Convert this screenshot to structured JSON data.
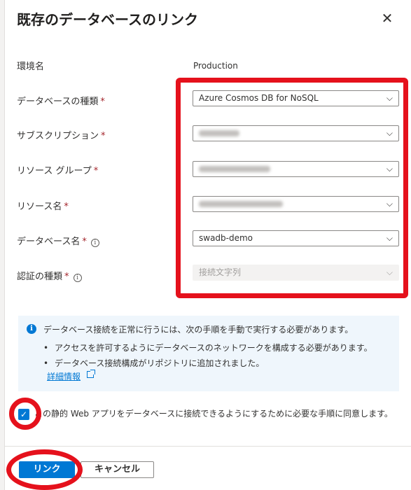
{
  "panel": {
    "title": "既存のデータベースのリンク",
    "close_symbol": "✕"
  },
  "fields": {
    "environment": {
      "label": "環境名",
      "value": "Production"
    },
    "db_type": {
      "label": "データベースの種類",
      "required": "*",
      "value": "Azure Cosmos DB for NoSQL"
    },
    "subscription": {
      "label": "サブスクリプション",
      "required": "*",
      "value": ""
    },
    "resource_group": {
      "label": "リソース グループ",
      "required": "*",
      "value": ""
    },
    "resource_name": {
      "label": "リソース名",
      "required": "*",
      "value": ""
    },
    "db_name": {
      "label": "データベース名",
      "required": "*",
      "info": "i",
      "value": "swadb-demo"
    },
    "auth_type": {
      "label": "認証の種類",
      "required": "*",
      "info": "i",
      "value": "接続文字列"
    }
  },
  "info_box": {
    "icon": "i",
    "message": "データベース接続を正常に行うには、次の手順を手動で実行する必要があります。",
    "bullets": [
      "アクセスを許可するようにデータベースのネットワークを構成する必要があります。",
      "データベース接続構成がリポジトリに追加されました。"
    ],
    "bullet_symbol": "•",
    "link": "詳細情報"
  },
  "consent": {
    "checked_symbol": "✓",
    "text": "この静的 Web アプリをデータベースに接続できるようにするために必要な手順に同意します。"
  },
  "buttons": {
    "link": "リンク",
    "cancel": "キャンセル"
  },
  "icons": {
    "chevron": "chevron-down-icon",
    "close": "close-icon",
    "info": "info-icon",
    "external": "external-link-icon",
    "check": "checkmark-icon"
  },
  "colors": {
    "accent": "#0078d4",
    "annotation": "#e5111c",
    "required": "#a4262c",
    "info_background": "#eff6fc"
  }
}
